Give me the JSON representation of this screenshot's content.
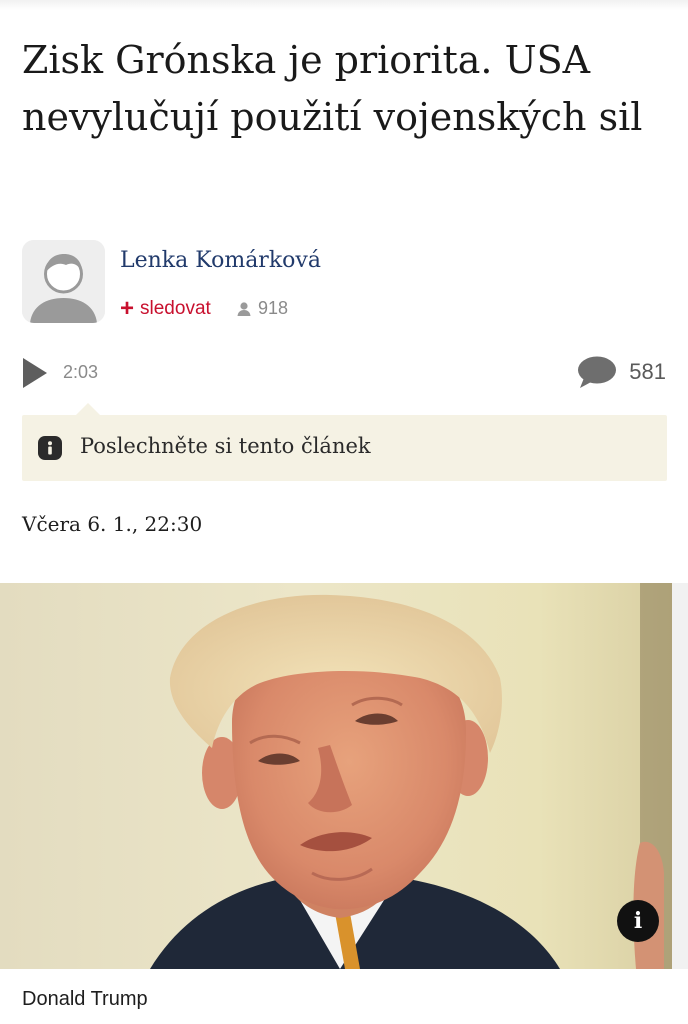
{
  "article": {
    "headline": "Zisk Grónska je priorita. USA nevylučují použití vojenských sil",
    "author": {
      "name": "Lenka Komárková",
      "follow_label": "sledovat",
      "followers": "918",
      "avatar_icon": "user-silhouette-icon"
    },
    "audio": {
      "duration": "2:03",
      "listen_label": "Poslechněte si tento článek"
    },
    "comments_count": "581",
    "dateline": "Včera 6. 1., 22:30",
    "photo": {
      "caption": "Donald Trump",
      "info_label": "i"
    }
  },
  "colors": {
    "author_link": "#213a6b",
    "follow_red": "#c8102e",
    "listen_bg": "#f5f2e4",
    "muted": "#8a8a8a"
  }
}
